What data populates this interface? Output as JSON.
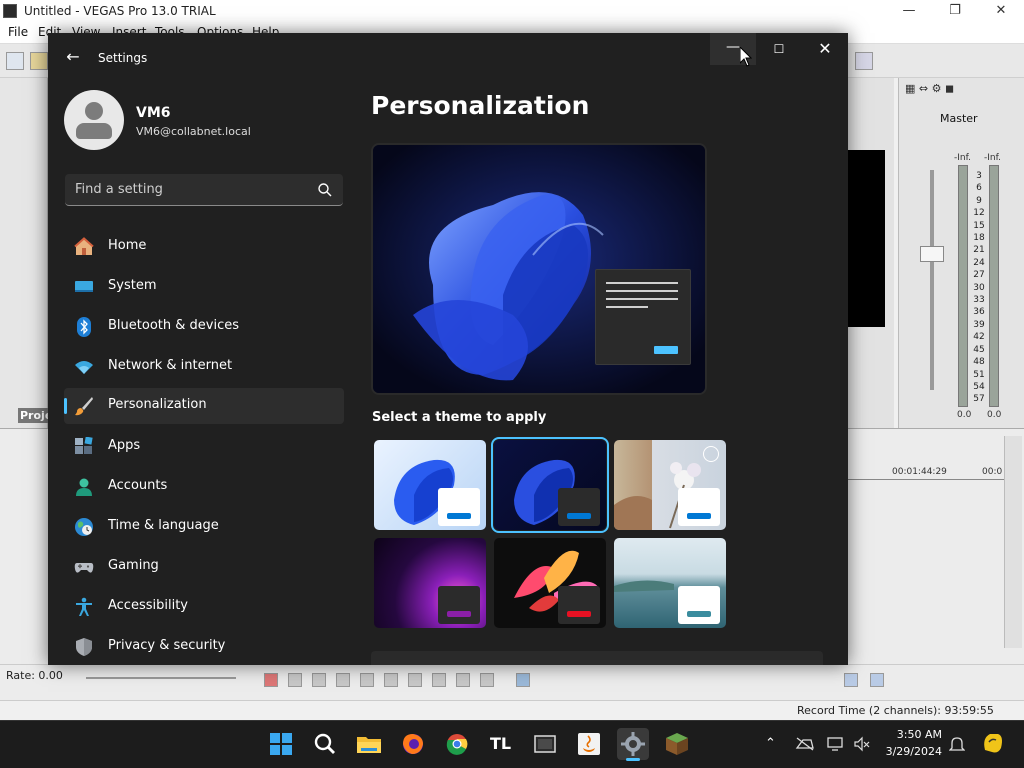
{
  "vegas": {
    "title": "Untitled - VEGAS Pro 13.0 TRIAL",
    "menu": [
      "File",
      "Edit",
      "View",
      "Insert",
      "Tools",
      "Options",
      "Help"
    ],
    "project_tab": "Proje",
    "mixer": {
      "bus_name": "Master",
      "peak_left": "-Inf.",
      "peak_right": "-Inf.",
      "scale": [
        "3",
        "6",
        "9",
        "12",
        "15",
        "18",
        "21",
        "24",
        "27",
        "30",
        "33",
        "36",
        "39",
        "42",
        "45",
        "48",
        "51",
        "54",
        "57"
      ],
      "floor_left": "0.0",
      "floor_right": "0.0"
    },
    "timecode_1": "00:01:44:29",
    "timecode_2": "00:0",
    "rate_label": "Rate: 0.00",
    "record_time": "Record Time (2 channels): 93:59:55"
  },
  "settings": {
    "window_title": "Settings",
    "user": {
      "name": "VM6",
      "email": "VM6@collabnet.local"
    },
    "search": {
      "placeholder": "Find a setting"
    },
    "nav": [
      {
        "label": "Home",
        "icon": "home-icon"
      },
      {
        "label": "System",
        "icon": "system-icon"
      },
      {
        "label": "Bluetooth & devices",
        "icon": "bluetooth-icon"
      },
      {
        "label": "Network & internet",
        "icon": "wifi-icon"
      },
      {
        "label": "Personalization",
        "icon": "brush-icon",
        "selected": true
      },
      {
        "label": "Apps",
        "icon": "apps-icon"
      },
      {
        "label": "Accounts",
        "icon": "accounts-icon"
      },
      {
        "label": "Time & language",
        "icon": "globe-clock-icon"
      },
      {
        "label": "Gaming",
        "icon": "gamepad-icon"
      },
      {
        "label": "Accessibility",
        "icon": "accessibility-icon"
      },
      {
        "label": "Privacy & security",
        "icon": "shield-icon"
      }
    ],
    "page_title": "Personalization",
    "theme_heading": "Select a theme to apply",
    "themes": [
      {
        "name": "light-bloom",
        "selected": false,
        "accent": "#0078d4"
      },
      {
        "name": "dark-bloom",
        "selected": true,
        "accent": "#0078d4"
      },
      {
        "name": "glow-flower",
        "selected": false,
        "accent": "#0078d4"
      },
      {
        "name": "purple-glow",
        "selected": false,
        "accent": "#8b1fa8"
      },
      {
        "name": "captured-motion",
        "selected": false,
        "accent": "#e81123"
      },
      {
        "name": "sunrise-lake",
        "selected": false,
        "accent": "#3a8c9e"
      }
    ],
    "accent_color": "#4cc2ff"
  },
  "taskbar": {
    "apps": [
      "start-icon",
      "search-icon",
      "file-explorer-icon",
      "firefox-icon",
      "chrome-icon",
      "tl-app-icon",
      "vegas-icon",
      "java-icon",
      "settings-icon",
      "minecraft-icon"
    ],
    "time": "3:50 AM",
    "date": "3/29/2024"
  }
}
